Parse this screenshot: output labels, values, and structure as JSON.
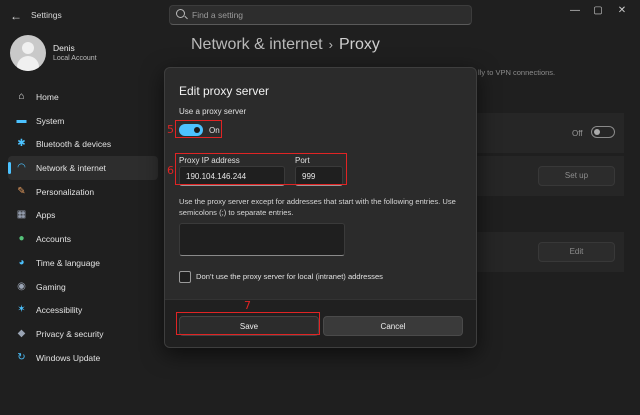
{
  "window": {
    "title": "Settings",
    "back_glyph": "←",
    "controls": [
      "—",
      "▢",
      "✕"
    ]
  },
  "search": {
    "placeholder": "Find a setting"
  },
  "user": {
    "name": "Denis",
    "account": "Local Account"
  },
  "sidebar": {
    "items": [
      {
        "label": "Home",
        "icon": "home-icon",
        "glyph": "⌂",
        "color": "#e3e3e3"
      },
      {
        "label": "System",
        "icon": "system-icon",
        "glyph": "▬",
        "color": "#4cc2ff"
      },
      {
        "label": "Bluetooth & devices",
        "icon": "bluetooth-icon",
        "glyph": "✱",
        "color": "#4cc2ff"
      },
      {
        "label": "Network & internet",
        "icon": "wifi-icon",
        "glyph": "◠",
        "color": "#4cc2ff",
        "active": true
      },
      {
        "label": "Personalization",
        "icon": "brush-icon",
        "glyph": "✎",
        "color": "#e39a5d"
      },
      {
        "label": "Apps",
        "icon": "apps-icon",
        "glyph": "▦",
        "color": "#aab4c8"
      },
      {
        "label": "Accounts",
        "icon": "accounts-icon",
        "glyph": "●",
        "color": "#55c27a"
      },
      {
        "label": "Time & language",
        "icon": "globe-icon",
        "glyph": "◕",
        "color": "#4cc2ff"
      },
      {
        "label": "Gaming",
        "icon": "controller-icon",
        "glyph": "◉",
        "color": "#9aa4b4"
      },
      {
        "label": "Accessibility",
        "icon": "accessibility-icon",
        "glyph": "✶",
        "color": "#4cc2ff"
      },
      {
        "label": "Privacy & security",
        "icon": "shield-icon",
        "glyph": "◆",
        "color": "#9aa4b4"
      },
      {
        "label": "Windows Update",
        "icon": "update-icon",
        "glyph": "↻",
        "color": "#4cc2ff"
      }
    ]
  },
  "page": {
    "crumb_parent": "Network & internet",
    "crumb_sep": "›",
    "crumb_current": "Proxy",
    "description_tail": "lly to VPN connections."
  },
  "background_settings": {
    "toggle_state": "Off",
    "setup_button": "Set up",
    "edit_button": "Edit"
  },
  "dialog": {
    "title": "Edit proxy server",
    "use_proxy_label": "Use a proxy server",
    "toggle_state": "On",
    "ip_label": "Proxy IP address",
    "ip_value": "190.104.146.244",
    "port_label": "Port",
    "port_value": "999",
    "exceptions_help": "Use the proxy server except for addresses that start with the following entries. Use semicolons (;) to separate entries.",
    "exceptions_value": "",
    "local_checkbox_label": "Don’t use the proxy server for local (intranet) addresses",
    "local_checkbox_checked": false,
    "save_button": "Save",
    "cancel_button": "Cancel"
  },
  "annotations": {
    "step_toggle": "5",
    "step_fields": "6",
    "step_save": "7"
  },
  "colors": {
    "accent": "#4cc2ff",
    "annotation": "#e02424"
  }
}
